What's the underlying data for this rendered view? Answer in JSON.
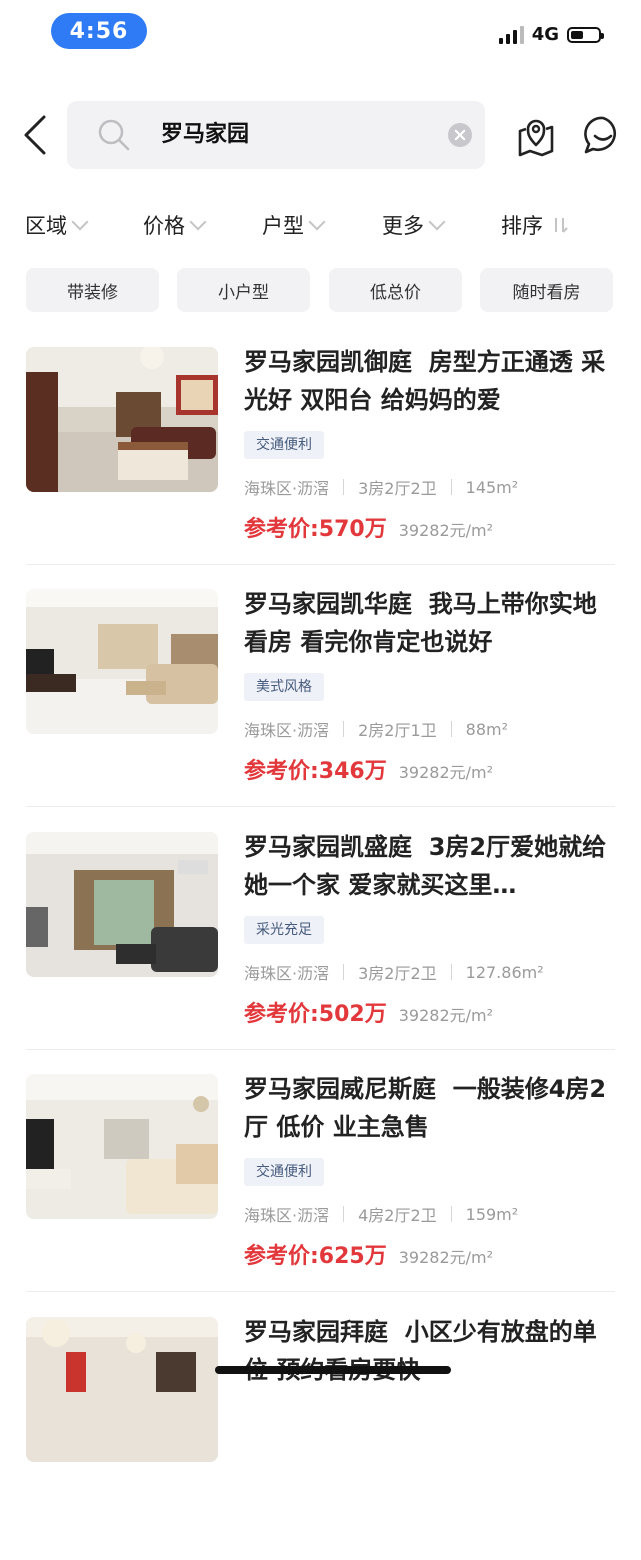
{
  "status": {
    "time": "4:56",
    "network": "4G"
  },
  "search": {
    "query": "罗马家园"
  },
  "filters": [
    "区域",
    "价格",
    "户型",
    "更多",
    "排序"
  ],
  "quick_tags": [
    "带装修",
    "小户型",
    "低总价",
    "随时看房"
  ],
  "listings": [
    {
      "title": "罗马家园凯御庭  房型方正通透 采光好 双阳台 给妈妈的爱",
      "tag": "交通便利",
      "district": "海珠区·沥滘",
      "layout": "3房2厅2卫",
      "area": "145m²",
      "price": "参考价:570万",
      "unit_price": "39282元/m²"
    },
    {
      "title": "罗马家园凯华庭  我马上带你实地看房 看完你肯定也说好",
      "tag": "美式风格",
      "district": "海珠区·沥滘",
      "layout": "2房2厅1卫",
      "area": "88m²",
      "price": "参考价:346万",
      "unit_price": "39282元/m²"
    },
    {
      "title": "罗马家园凯盛庭  3房2厅爱她就给她一个家 爱家就买这里…",
      "tag": "采光充足",
      "district": "海珠区·沥滘",
      "layout": "3房2厅2卫",
      "area": "127.86m²",
      "price": "参考价:502万",
      "unit_price": "39282元/m²"
    },
    {
      "title": "罗马家园威尼斯庭  一般装修4房2厅 低价 业主急售",
      "tag": "交通便利",
      "district": "海珠区·沥滘",
      "layout": "4房2厅2卫",
      "area": "159m²",
      "price": "参考价:625万",
      "unit_price": "39282元/m²"
    },
    {
      "title": "罗马家园拜庭  小区少有放盘的单位 预约看房要快",
      "tag": "",
      "district": "",
      "layout": "",
      "area": "",
      "price": "",
      "unit_price": ""
    }
  ],
  "colors": {
    "accent": "#2f7bf5",
    "price": "#e2373b",
    "tag_bg": "#eef1f7",
    "tag_text": "#475b7d"
  }
}
